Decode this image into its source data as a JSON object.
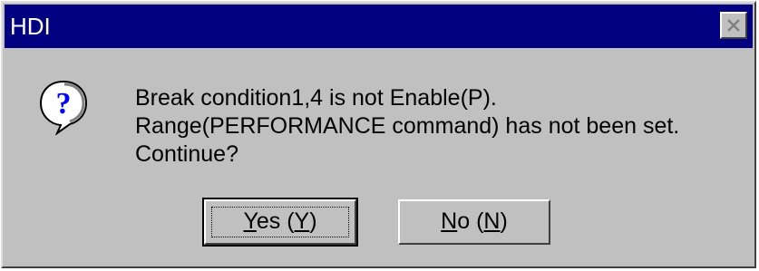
{
  "window": {
    "title": "HDI"
  },
  "icons": {
    "message_icon": "question-icon",
    "close_icon": "close-icon"
  },
  "message": {
    "lines": [
      "Break condition1,4 is not Enable(P).",
      "Range(PERFORMANCE command) has not been set.",
      "Continue?"
    ]
  },
  "buttons": {
    "yes": {
      "label": "Yes (Y)",
      "prefix": "",
      "mnemonic_first": "Y",
      "middle": "es (",
      "mnemonic_second": "Y",
      "suffix": ")"
    },
    "no": {
      "label": "No (N)",
      "mnemonic_first": "N",
      "middle": "o (",
      "mnemonic_second": "N",
      "suffix": ")"
    }
  },
  "colors": {
    "titlebar": "#000080",
    "dialog_face": "#c0c0c0",
    "icon_blue": "#0000ff"
  }
}
